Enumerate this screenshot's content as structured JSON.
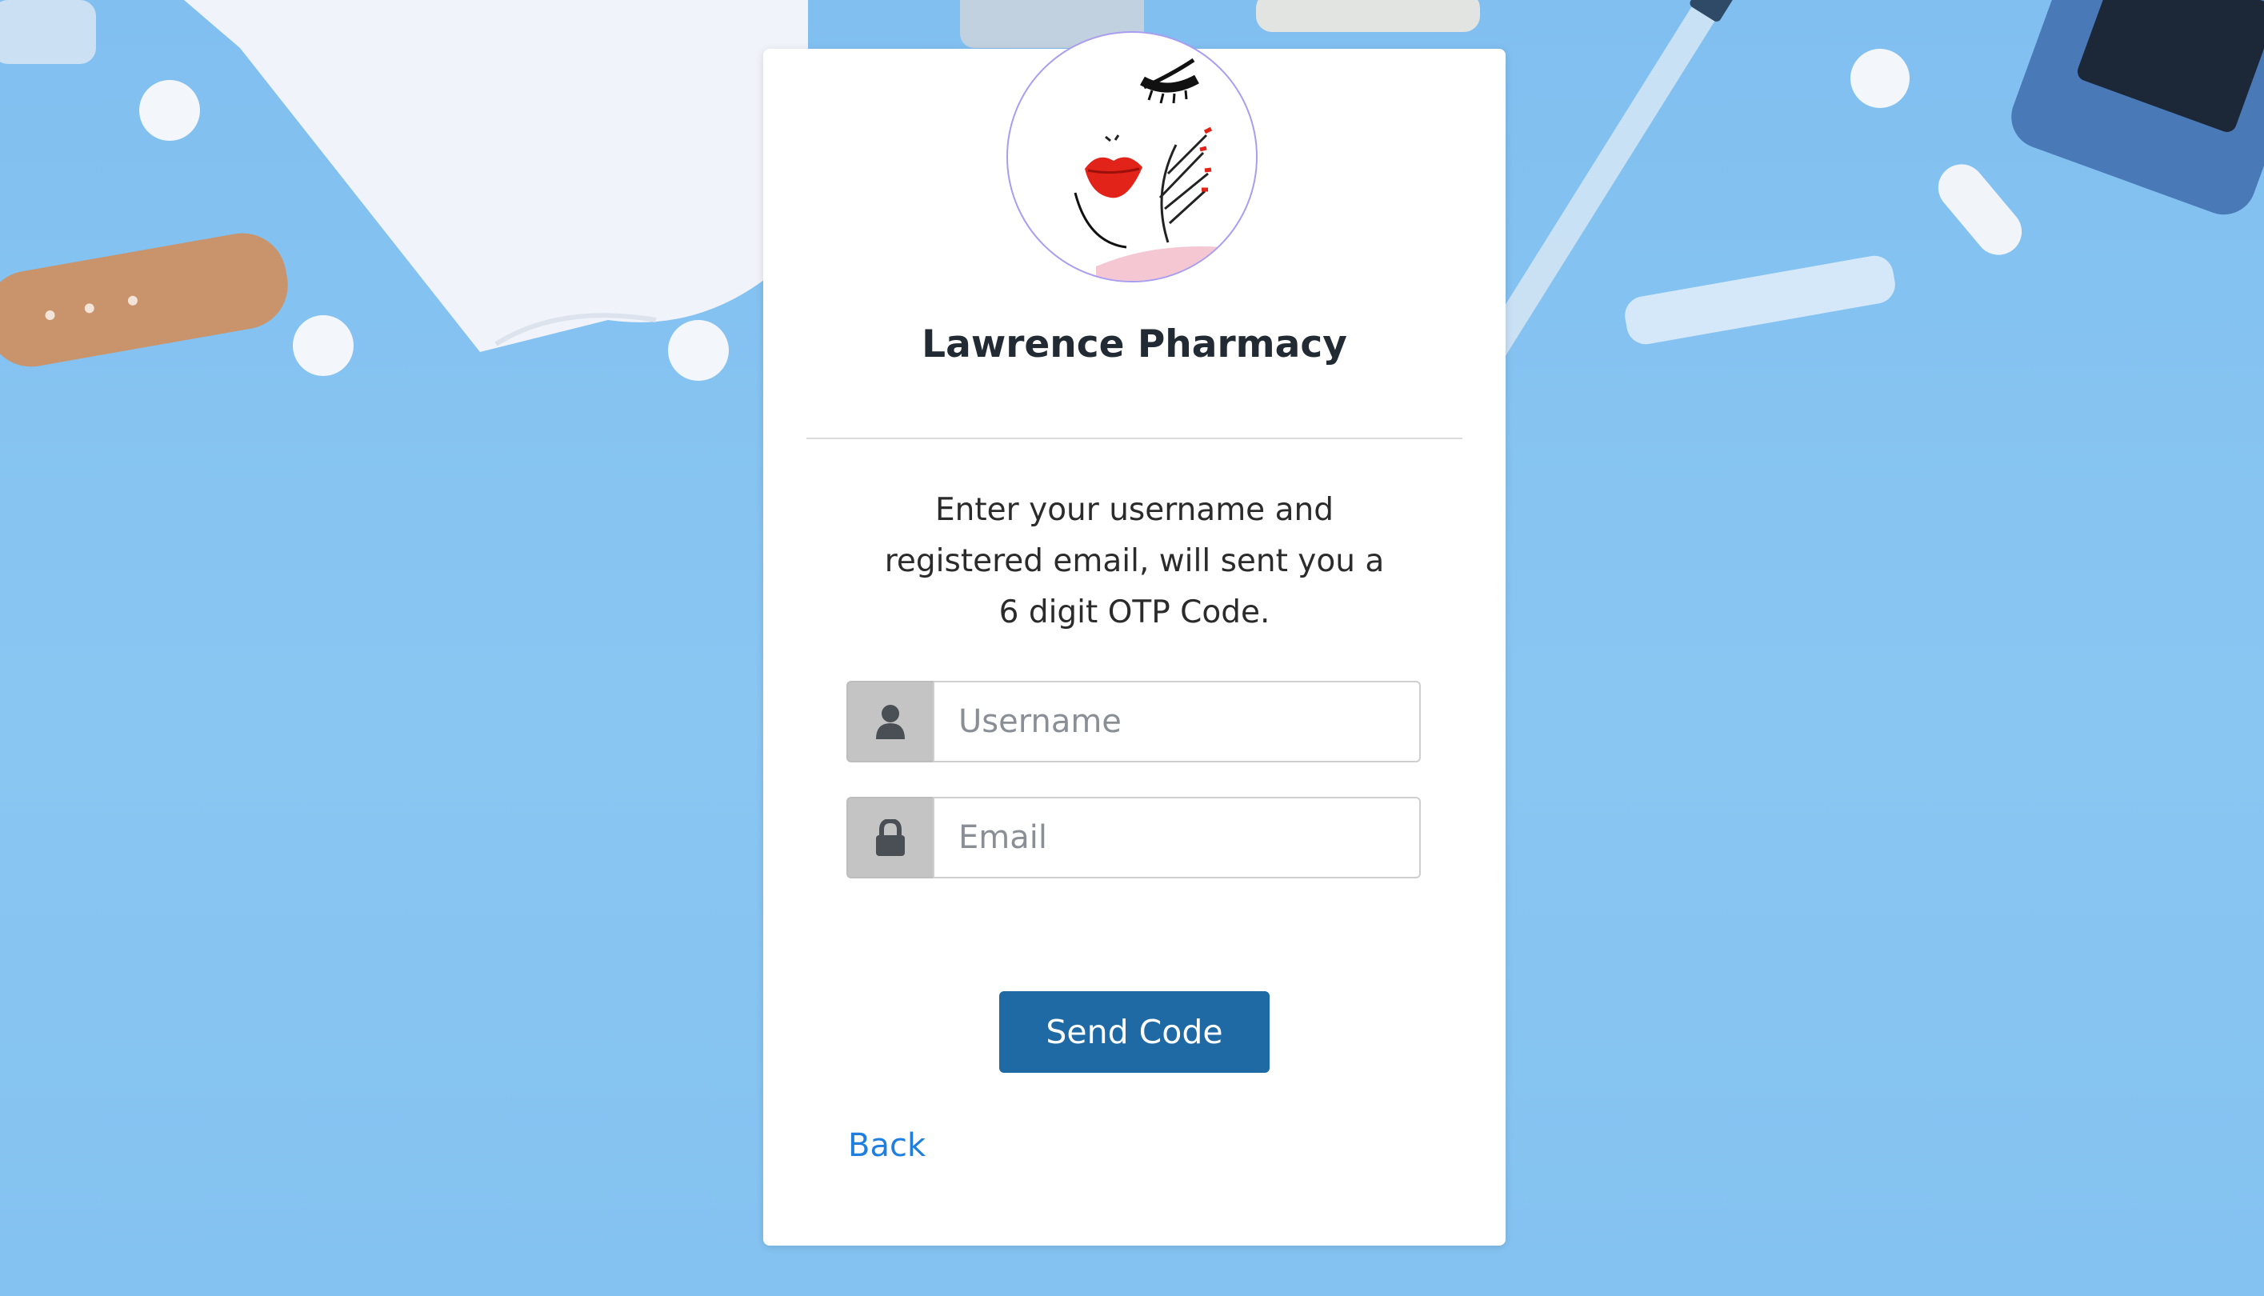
{
  "brand": {
    "name": "Lawrence Pharmacy"
  },
  "form": {
    "instructions_line1": "Enter your username and",
    "instructions_line2": "registered email, will sent you a",
    "instructions_line3": "6 digit OTP Code.",
    "username": {
      "placeholder": "Username",
      "value": "",
      "icon": "user-icon"
    },
    "email": {
      "placeholder": "Email",
      "value": "",
      "icon": "lock-icon"
    },
    "send_label": "Send Code",
    "back_label": "Back"
  },
  "theme": {
    "background": "#86c3f1",
    "button": "#1f6aa5",
    "link": "#1e7fe0",
    "addon": "#c4c4c4"
  }
}
